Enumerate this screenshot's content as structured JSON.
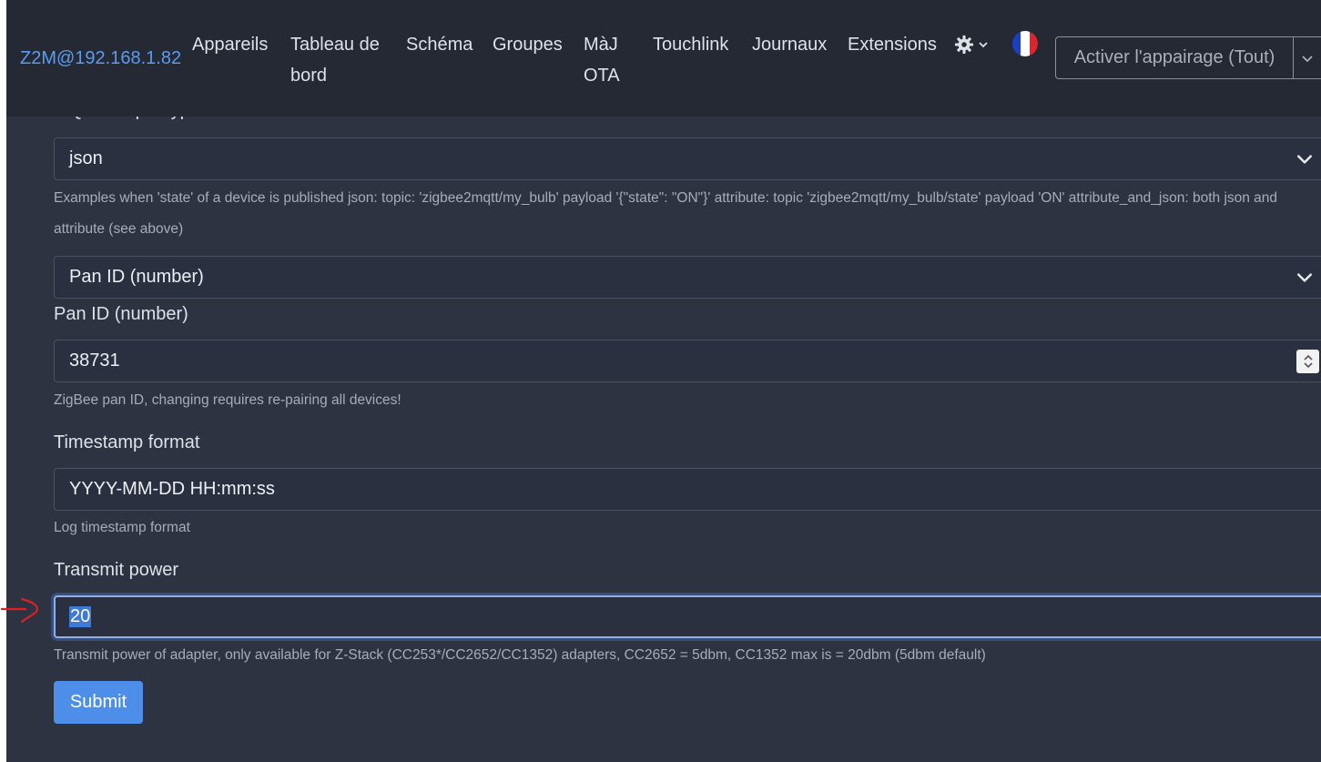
{
  "navbar": {
    "brand": "Z2M@192.168.1.82",
    "items": [
      {
        "line1": "Appareils",
        "line2": ""
      },
      {
        "line1": "Tableau de",
        "line2": "bord"
      },
      {
        "line1": "Schéma",
        "line2": ""
      },
      {
        "line1": "Groupes",
        "line2": ""
      },
      {
        "line1": "MàJ",
        "line2": "OTA"
      },
      {
        "line1": "Touchlink",
        "line2": ""
      },
      {
        "line1": "Journaux",
        "line2": ""
      },
      {
        "line1": "Extensions",
        "line2": ""
      }
    ],
    "settings_icon": "gear-icon",
    "language_flag": "france-flag-icon",
    "pairing_button": "Activer l'appairage (Tout)"
  },
  "form": {
    "mqtt_output": {
      "label": "MQTT output type",
      "value": "json",
      "help": "Examples when 'state' of a device is published json: topic: 'zigbee2mqtt/my_bulb' payload '{\"state\": \"ON\"}' attribute: topic 'zigbee2mqtt/my_bulb/state' payload 'ON' attribute_and_json: both json and attribute (see above)"
    },
    "pan_id_select": {
      "value": "Pan ID (number)"
    },
    "pan_id": {
      "label": "Pan ID (number)",
      "value": "38731",
      "help": "ZigBee pan ID, changing requires re-pairing all devices!"
    },
    "timestamp_format": {
      "label": "Timestamp format",
      "value": "YYYY-MM-DD HH:mm:ss",
      "help": "Log timestamp format"
    },
    "transmit_power": {
      "label": "Transmit power",
      "value": "20",
      "help": "Transmit power of adapter, only available for Z-Stack (CC253*/CC2652/CC1352) adapters, CC2652 = 5dbm, CC1352 max is = 20dbm (5dbm default)"
    },
    "submit_label": "Submit"
  },
  "colors": {
    "background": "#2e3342",
    "navbar": "#252934",
    "brand": "#5a9bef",
    "primary_button": "#4d8fe8",
    "annotation": "#e02020"
  }
}
